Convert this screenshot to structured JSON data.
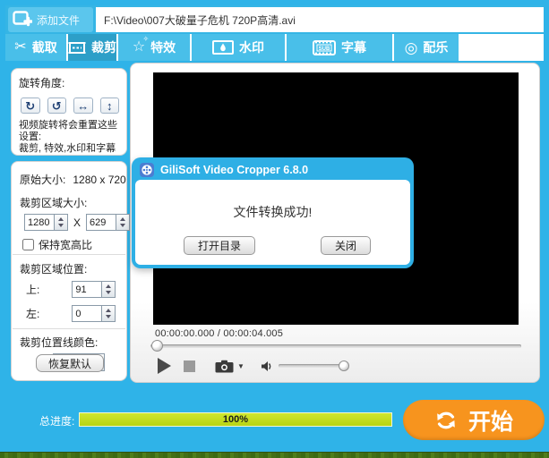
{
  "header": {
    "add_file": "添加文件",
    "file_path": "F:\\Video\\007大破量子危机 720P高清.avi"
  },
  "tabs": {
    "capture": "截取",
    "crop": "裁剪",
    "effects": "特效",
    "watermark": "水印",
    "subtitle": "字幕",
    "music": "配乐",
    "subtitle_icon_text": "SUB",
    "selected_tab": "裁剪"
  },
  "sidebar": {
    "rotation_label": "旋转角度:",
    "rotation_warning_1": "视频旋转将会重置这些设置:",
    "rotation_warning_2": "裁剪, 特效,水印和字幕",
    "original_size_label": "原始大小:",
    "original_size_value": "1280 x 720",
    "crop_size_label": "裁剪区域大小:",
    "crop_width": "1280",
    "size_separator": "X",
    "crop_height": "629",
    "keep_aspect_label": "保持宽高比",
    "keep_aspect_checked": false,
    "crop_pos_label": "裁剪区域位置:",
    "pos_top_label": "上:",
    "pos_top_value": "91",
    "pos_left_label": "左:",
    "pos_left_value": "0",
    "line_color_label": "裁剪位置线颜色:",
    "line_color_value": "#FFFFFF",
    "restore_default": "恢复默认"
  },
  "player": {
    "time_display": "00:00:00.000 / 00:00:04.005",
    "seek_position_percent": 0,
    "volume_percent": 100
  },
  "dialog": {
    "title": "GiliSoft Video Cropper 6.8.0",
    "message": "文件转换成功!",
    "open_dir": "打开目录",
    "close": "关闭"
  },
  "footer": {
    "progress_label": "总进度:",
    "progress_text": "100%",
    "progress_percent": 100,
    "start_label": "开始"
  },
  "icons": {
    "scissors": "✂",
    "star": "☆",
    "star_small": "✧",
    "music_disc": "◎",
    "rotate_cw": "↻",
    "rotate_ccw": "↺",
    "flip_h": "↔",
    "flip_v": "↕",
    "camera_dropdown": "▼"
  },
  "colors": {
    "window_blue": "#2FB3E8",
    "tab_blue": "#49BFE9",
    "tab_selected_blue": "#2D9FC8",
    "dialog_blue": "#2EAFE5",
    "accent_orange": "#F7941E",
    "progress_green": "#C3DC28",
    "grass_green": "#4F7E1C"
  }
}
